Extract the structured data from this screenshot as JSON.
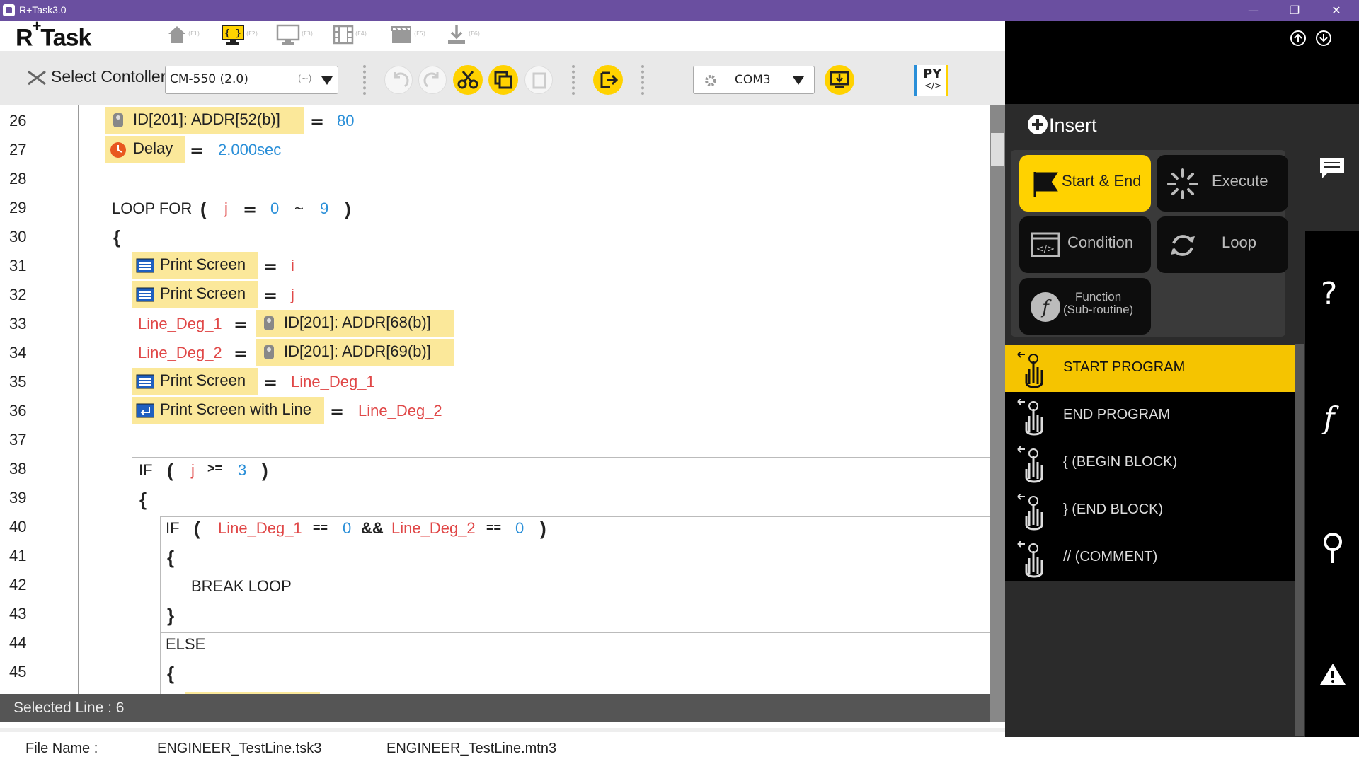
{
  "window": {
    "title": "R+Task3.0",
    "minimize": "—",
    "restore": "❐",
    "close": "✕"
  },
  "logo": {
    "main": "R",
    "plus": "+",
    "rest": "Task"
  },
  "toolbar": {
    "keys": [
      "(F1)",
      "(F2)",
      "(F3)",
      "(F4)",
      "(F5)",
      "(F6)"
    ],
    "select_controller_label": "Select Contoller",
    "controller_value": "CM-550 (2.0)",
    "controller_suffix": "(~)",
    "port_value": "COM3",
    "py_label": "PY"
  },
  "editor": {
    "line_numbers": [
      "26",
      "27",
      "28",
      "29",
      "30",
      "31",
      "32",
      "33",
      "34",
      "35",
      "36",
      "37",
      "38",
      "39",
      "40",
      "41",
      "42",
      "43",
      "44",
      "45"
    ],
    "l26": {
      "block": "ID[201]: ADDR[52(b)]",
      "eq": "=",
      "value": "80"
    },
    "l27": {
      "block": "Delay",
      "eq": "=",
      "value": "2.000sec"
    },
    "l29": {
      "kw": "LOOP FOR",
      "open": "(",
      "var": "j",
      "eq": "=",
      "from": "0",
      "tilde": "~",
      "to": "9",
      "close": ")"
    },
    "l30": {
      "brace": "{"
    },
    "l31": {
      "block": "Print Screen",
      "eq": "=",
      "value": "i"
    },
    "l32": {
      "block": "Print Screen",
      "eq": "=",
      "value": "j"
    },
    "l33": {
      "var": "Line_Deg_1",
      "eq": "=",
      "block": "ID[201]: ADDR[68(b)]"
    },
    "l34": {
      "var": "Line_Deg_2",
      "eq": "=",
      "block": "ID[201]: ADDR[69(b)]"
    },
    "l35": {
      "block": "Print Screen",
      "eq": "=",
      "value": "Line_Deg_1"
    },
    "l36": {
      "block": "Print Screen with Line",
      "eq": "=",
      "value": "Line_Deg_2"
    },
    "l38": {
      "kw": "IF",
      "open": "(",
      "var": "j",
      "op": ">=",
      "value": "3",
      "close": ")"
    },
    "l39": {
      "brace": "{"
    },
    "l40": {
      "kw": "IF",
      "open": "(",
      "var1": "Line_Deg_1",
      "op1": "==",
      "val1": "0",
      "and": "&&",
      "var2": "Line_Deg_2",
      "op2": "==",
      "val2": "0",
      "close": ")"
    },
    "l41": {
      "brace": "{"
    },
    "l42": {
      "kw": "BREAK LOOP"
    },
    "l43": {
      "brace": "}"
    },
    "l44": {
      "kw": "ELSE"
    },
    "l45": {
      "brace": "{"
    }
  },
  "status": {
    "selected_line": "Selected Line : 6"
  },
  "file": {
    "label": "File Name :",
    "task_file": "ENGINEER_TestLine.tsk3",
    "motion_file": "ENGINEER_TestLine.mtn3"
  },
  "insert": {
    "title": "Insert",
    "categories": [
      {
        "label": "Start & End"
      },
      {
        "label": "Execute"
      },
      {
        "label": "Condition"
      },
      {
        "label": "Loop"
      },
      {
        "label": "Function\n(Sub-routine)"
      }
    ],
    "items": [
      {
        "label": "START PROGRAM"
      },
      {
        "label": "END PROGRAM"
      },
      {
        "label": "{  (BEGIN BLOCK)"
      },
      {
        "label": "}  (END BLOCK)"
      },
      {
        "label": "//  (COMMENT)"
      }
    ]
  },
  "sidebar": {
    "help": "?",
    "func": "f"
  },
  "colors": {
    "accent": "#ffd200",
    "titlebar": "#6a4fa0",
    "variable": "#e04848",
    "number": "#2a8fd8",
    "block": "#fbe89a"
  }
}
